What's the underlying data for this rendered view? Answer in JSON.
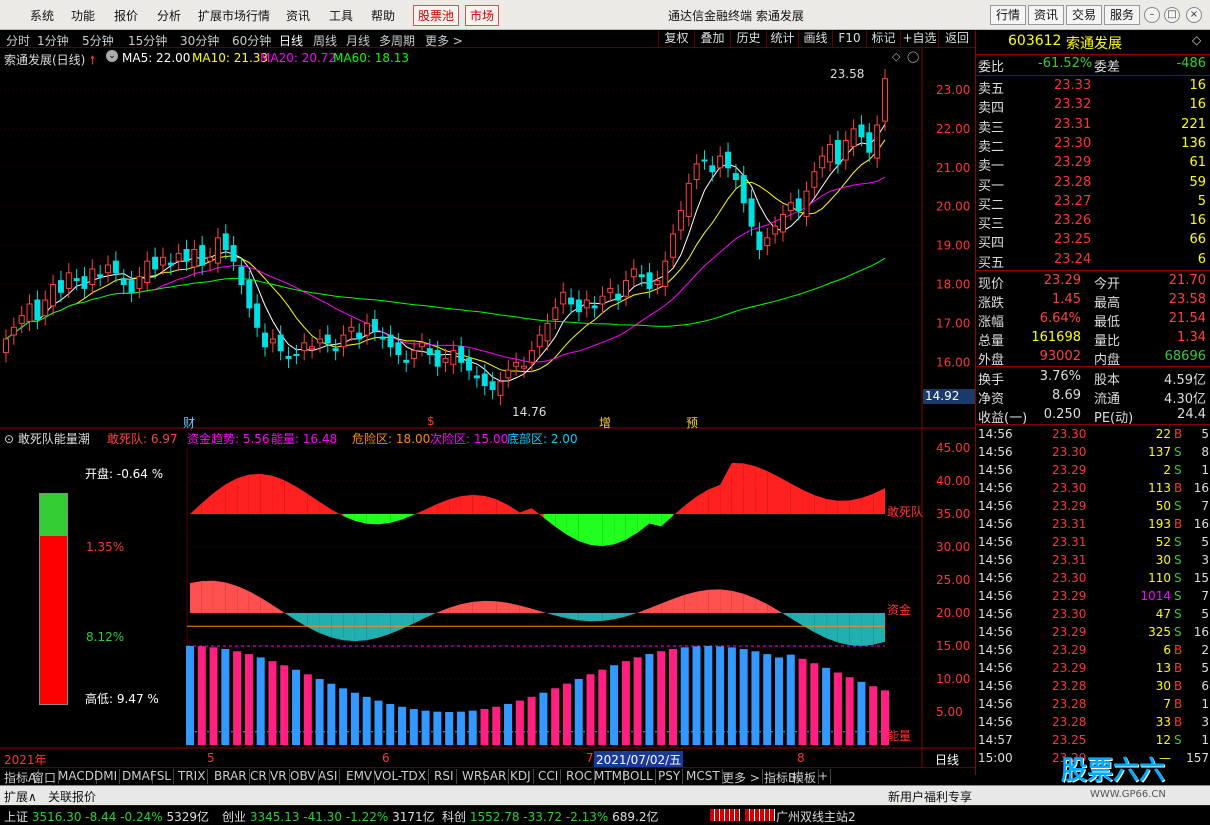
{
  "menu": {
    "items": [
      "系统",
      "功能",
      "报价",
      "分析",
      "扩展市场行情",
      "资讯",
      "工具",
      "帮助"
    ],
    "hot_items": [
      "股票池",
      "市场"
    ],
    "title": "通达信金融终端  索通发展",
    "right_buttons": [
      "行情",
      "资讯",
      "交易",
      "服务"
    ]
  },
  "periods": [
    "分时",
    "1分钟",
    "5分钟",
    "15分钟",
    "30分钟",
    "60分钟",
    "日线",
    "周线",
    "月线",
    "多周期",
    "更多 >"
  ],
  "selected_period": "日线",
  "toolbar": [
    "复权",
    "叠加",
    "历史",
    "统计",
    "画线",
    "F10",
    "标记",
    "+自选",
    "返回"
  ],
  "kline": {
    "title": "索通发展(日线)",
    "ma": [
      {
        "label": "MA5: 22.00",
        "color": "#ffffff"
      },
      {
        "label": "MA10: 21.33",
        "color": "#ffff00"
      },
      {
        "label": "MA20: 20.72",
        "color": "#ff00ff"
      },
      {
        "label": "MA60: 18.13",
        "color": "#00ff00"
      }
    ],
    "price_axis": [
      "23.00",
      "22.00",
      "21.00",
      "20.00",
      "19.00",
      "18.00",
      "17.00",
      "16.00"
    ],
    "high_label": "23.58",
    "low_label": "14.76",
    "cursor_price": "14.92",
    "event_tags": [
      "财",
      "$",
      "增",
      "预"
    ]
  },
  "indicator": {
    "title": "敢死队能量潮",
    "params": [
      {
        "label": "敢死队: 6.97",
        "color": "#ff4040"
      },
      {
        "label": "资金趋势: 5.56",
        "color": "#ff00ff"
      },
      {
        "label": "能量: 16.48",
        "color": "#ff00ff"
      },
      {
        "label": "危险区: 18.00",
        "color": "#ff8c00"
      },
      {
        "label": "次险区: 15.00",
        "color": "#ff00ff"
      },
      {
        "label": "底部区: 2.00",
        "color": "#00c8ff"
      }
    ],
    "axis": [
      "45.00",
      "40.00",
      "35.00",
      "30.00",
      "25.00",
      "20.00",
      "15.00",
      "10.00",
      "5.00"
    ],
    "series_labels": [
      "敢死队",
      "资金",
      "能量"
    ],
    "gauge": {
      "open": "开盘: -0.64 %",
      "top_pct": "1.35%",
      "mid_pct": "8.12%",
      "low": "高低: 9.47 %",
      "green_fraction": 0.2
    }
  },
  "time_axis": [
    "2021年",
    "5",
    "6",
    "7",
    "8"
  ],
  "cursor_date": "2021/07/02/五",
  "period_label": "日线",
  "indicator_tabs": [
    "指标A",
    "窗口",
    "MACD",
    "DMI",
    "DMA",
    "FSL",
    "TRIX",
    "BRAR",
    "CR",
    "VR",
    "OBV",
    "ASI",
    "EMV",
    "VOL-TDX",
    "RSI",
    "WR",
    "SAR",
    "KDJ",
    "CCI",
    "ROC",
    "MTM",
    "BOLL",
    "PSY",
    "MCST",
    "更多 >",
    "指标B",
    "模板",
    "+"
  ],
  "bottom_tabs": [
    "扩展∧",
    "关联报价"
  ],
  "bottom_right": "新用户福利专享",
  "quote": {
    "code": "603612",
    "name": "索通发展",
    "weibi_label": "委比",
    "weibi": "-61.52%",
    "weicha_label": "委差",
    "weicha": "-486",
    "sells": [
      {
        "label": "卖五",
        "price": "23.33",
        "vol": "16"
      },
      {
        "label": "卖四",
        "price": "23.32",
        "vol": "16"
      },
      {
        "label": "卖三",
        "price": "23.31",
        "vol": "221"
      },
      {
        "label": "卖二",
        "price": "23.30",
        "vol": "136"
      },
      {
        "label": "卖一",
        "price": "23.29",
        "vol": "61"
      }
    ],
    "buys": [
      {
        "label": "买一",
        "price": "23.28",
        "vol": "59"
      },
      {
        "label": "买二",
        "price": "23.27",
        "vol": "5"
      },
      {
        "label": "买三",
        "price": "23.26",
        "vol": "16"
      },
      {
        "label": "买四",
        "price": "23.25",
        "vol": "66"
      },
      {
        "label": "买五",
        "price": "23.24",
        "vol": "6"
      }
    ],
    "stats": [
      {
        "l1": "现价",
        "v1": "23.29",
        "c1": "#ff4040",
        "l2": "今开",
        "v2": "21.70",
        "c2": "#ff4040"
      },
      {
        "l1": "涨跌",
        "v1": "1.45",
        "c1": "#ff4040",
        "l2": "最高",
        "v2": "23.58",
        "c2": "#ff4040"
      },
      {
        "l1": "涨幅",
        "v1": "6.64%",
        "c1": "#ff4040",
        "l2": "最低",
        "v2": "21.54",
        "c2": "#ff4040"
      },
      {
        "l1": "总量",
        "v1": "161698",
        "c1": "#ffff00",
        "l2": "量比",
        "v2": "1.34",
        "c2": "#ff4040"
      },
      {
        "l1": "外盘",
        "v1": "93002",
        "c1": "#ff4040",
        "l2": "内盘",
        "v2": "68696",
        "c2": "#3c3"
      }
    ],
    "stats2": [
      {
        "l1": "换手",
        "v1": "3.76%",
        "c1": "#dddddd",
        "l2": "股本",
        "v2": "4.59亿",
        "c2": "#dddddd"
      },
      {
        "l1": "净资",
        "v1": "8.69",
        "c1": "#dddddd",
        "l2": "流通",
        "v2": "4.30亿",
        "c2": "#dddddd"
      },
      {
        "l1": "收益(一)",
        "v1": "0.250",
        "c1": "#dddddd",
        "l2": "PE(动)",
        "v2": "24.4",
        "c2": "#dddddd"
      }
    ]
  },
  "ticks": [
    {
      "t": "14:56",
      "p": "23.30",
      "v": "22",
      "d": "B",
      "n": "5"
    },
    {
      "t": "14:56",
      "p": "23.30",
      "v": "137",
      "d": "S",
      "n": "8"
    },
    {
      "t": "14:56",
      "p": "23.29",
      "v": "2",
      "d": "S",
      "n": "1"
    },
    {
      "t": "14:56",
      "p": "23.30",
      "v": "113",
      "d": "B",
      "n": "16"
    },
    {
      "t": "14:56",
      "p": "23.29",
      "v": "50",
      "d": "S",
      "n": "7"
    },
    {
      "t": "14:56",
      "p": "23.31",
      "v": "193",
      "d": "B",
      "n": "16"
    },
    {
      "t": "14:56",
      "p": "23.31",
      "v": "52",
      "d": "S",
      "n": "5"
    },
    {
      "t": "14:56",
      "p": "23.31",
      "v": "30",
      "d": "S",
      "n": "3"
    },
    {
      "t": "14:56",
      "p": "23.30",
      "v": "110",
      "d": "S",
      "n": "15"
    },
    {
      "t": "14:56",
      "p": "23.29",
      "v": "1014",
      "d": "S",
      "n": "7"
    },
    {
      "t": "14:56",
      "p": "23.30",
      "v": "47",
      "d": "S",
      "n": "5"
    },
    {
      "t": "14:56",
      "p": "23.29",
      "v": "325",
      "d": "S",
      "n": "16"
    },
    {
      "t": "14:56",
      "p": "23.29",
      "v": "6",
      "d": "B",
      "n": "2"
    },
    {
      "t": "14:56",
      "p": "23.29",
      "v": "13",
      "d": "B",
      "n": "5"
    },
    {
      "t": "14:56",
      "p": "23.28",
      "v": "30",
      "d": "B",
      "n": "6"
    },
    {
      "t": "14:56",
      "p": "23.28",
      "v": "7",
      "d": "B",
      "n": "1"
    },
    {
      "t": "14:56",
      "p": "23.28",
      "v": "33",
      "d": "B",
      "n": "3"
    },
    {
      "t": "14:57",
      "p": "23.25",
      "v": "12",
      "d": "S",
      "n": "1"
    },
    {
      "t": "15:00",
      "p": "23.29",
      "v": "—",
      "d": "",
      "n": "157"
    }
  ],
  "status": [
    {
      "name": "上证",
      "v": "3516.30",
      "ch": "-8.44",
      "pct": "-0.24%",
      "amt": "5329亿"
    },
    {
      "name": "创业",
      "v": "3345.13",
      "ch": "-41.30",
      "pct": "-1.22%",
      "amt": "3171亿"
    },
    {
      "name": "科创",
      "v": "1552.78",
      "ch": "-33.72",
      "pct": "-2.13%",
      "amt": "689.2亿"
    }
  ],
  "status_right": "广州双线主站2",
  "watermark": "股票六六",
  "watermark_url": "WWW.GP66.CN",
  "colors": {
    "up": "#ff4040",
    "down": "#00e0e0",
    "grid": "#5a0000",
    "ma5": "#ffffff",
    "ma10": "#ffff00",
    "ma20": "#ff00ff",
    "ma60": "#00ff00"
  }
}
